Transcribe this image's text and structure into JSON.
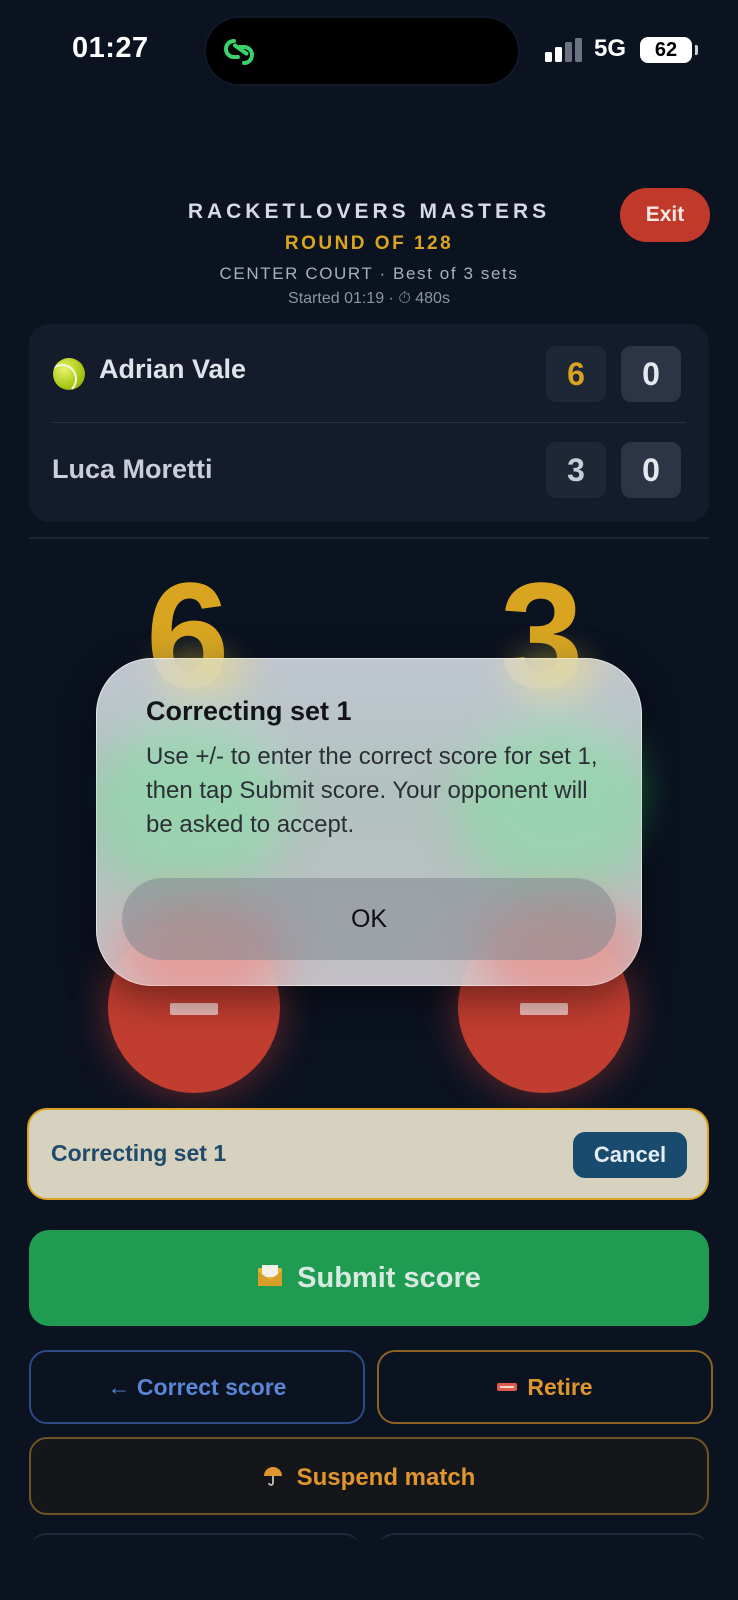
{
  "status_bar": {
    "time": "01:27",
    "network": "5G",
    "battery": "62"
  },
  "header": {
    "title": "RACKETLOVERS MASTERS",
    "round": "ROUND OF 128",
    "court_line": "CENTER COURT · Best of 3 sets",
    "started_line": "Started 01:19 · ⏱ 480s",
    "exit_label": "Exit"
  },
  "scoreboard": {
    "players": [
      {
        "name": "Adrian Vale",
        "serving": true,
        "sets": [
          "6",
          "0"
        ]
      },
      {
        "name": "Luca Moretti",
        "serving": false,
        "sets": [
          "3",
          "0"
        ]
      }
    ]
  },
  "current_set": {
    "left_games": "6",
    "right_games": "3"
  },
  "modal": {
    "title": "Correcting set 1",
    "body": "Use +/- to enter the correct score for set 1, then tap Submit score. Your opponent will be asked to accept.",
    "ok_label": "OK"
  },
  "correction_banner": {
    "text": "Correcting set 1",
    "cancel_label": "Cancel"
  },
  "actions": {
    "submit_label": "Submit score",
    "correct_label": "← Correct score",
    "retire_label": "Retire",
    "suspend_label": "Suspend match"
  },
  "colors": {
    "accent_gold": "#d9a520",
    "exit_red": "#c0392b",
    "submit_green": "#1f9b52",
    "background": "#0b1220"
  }
}
